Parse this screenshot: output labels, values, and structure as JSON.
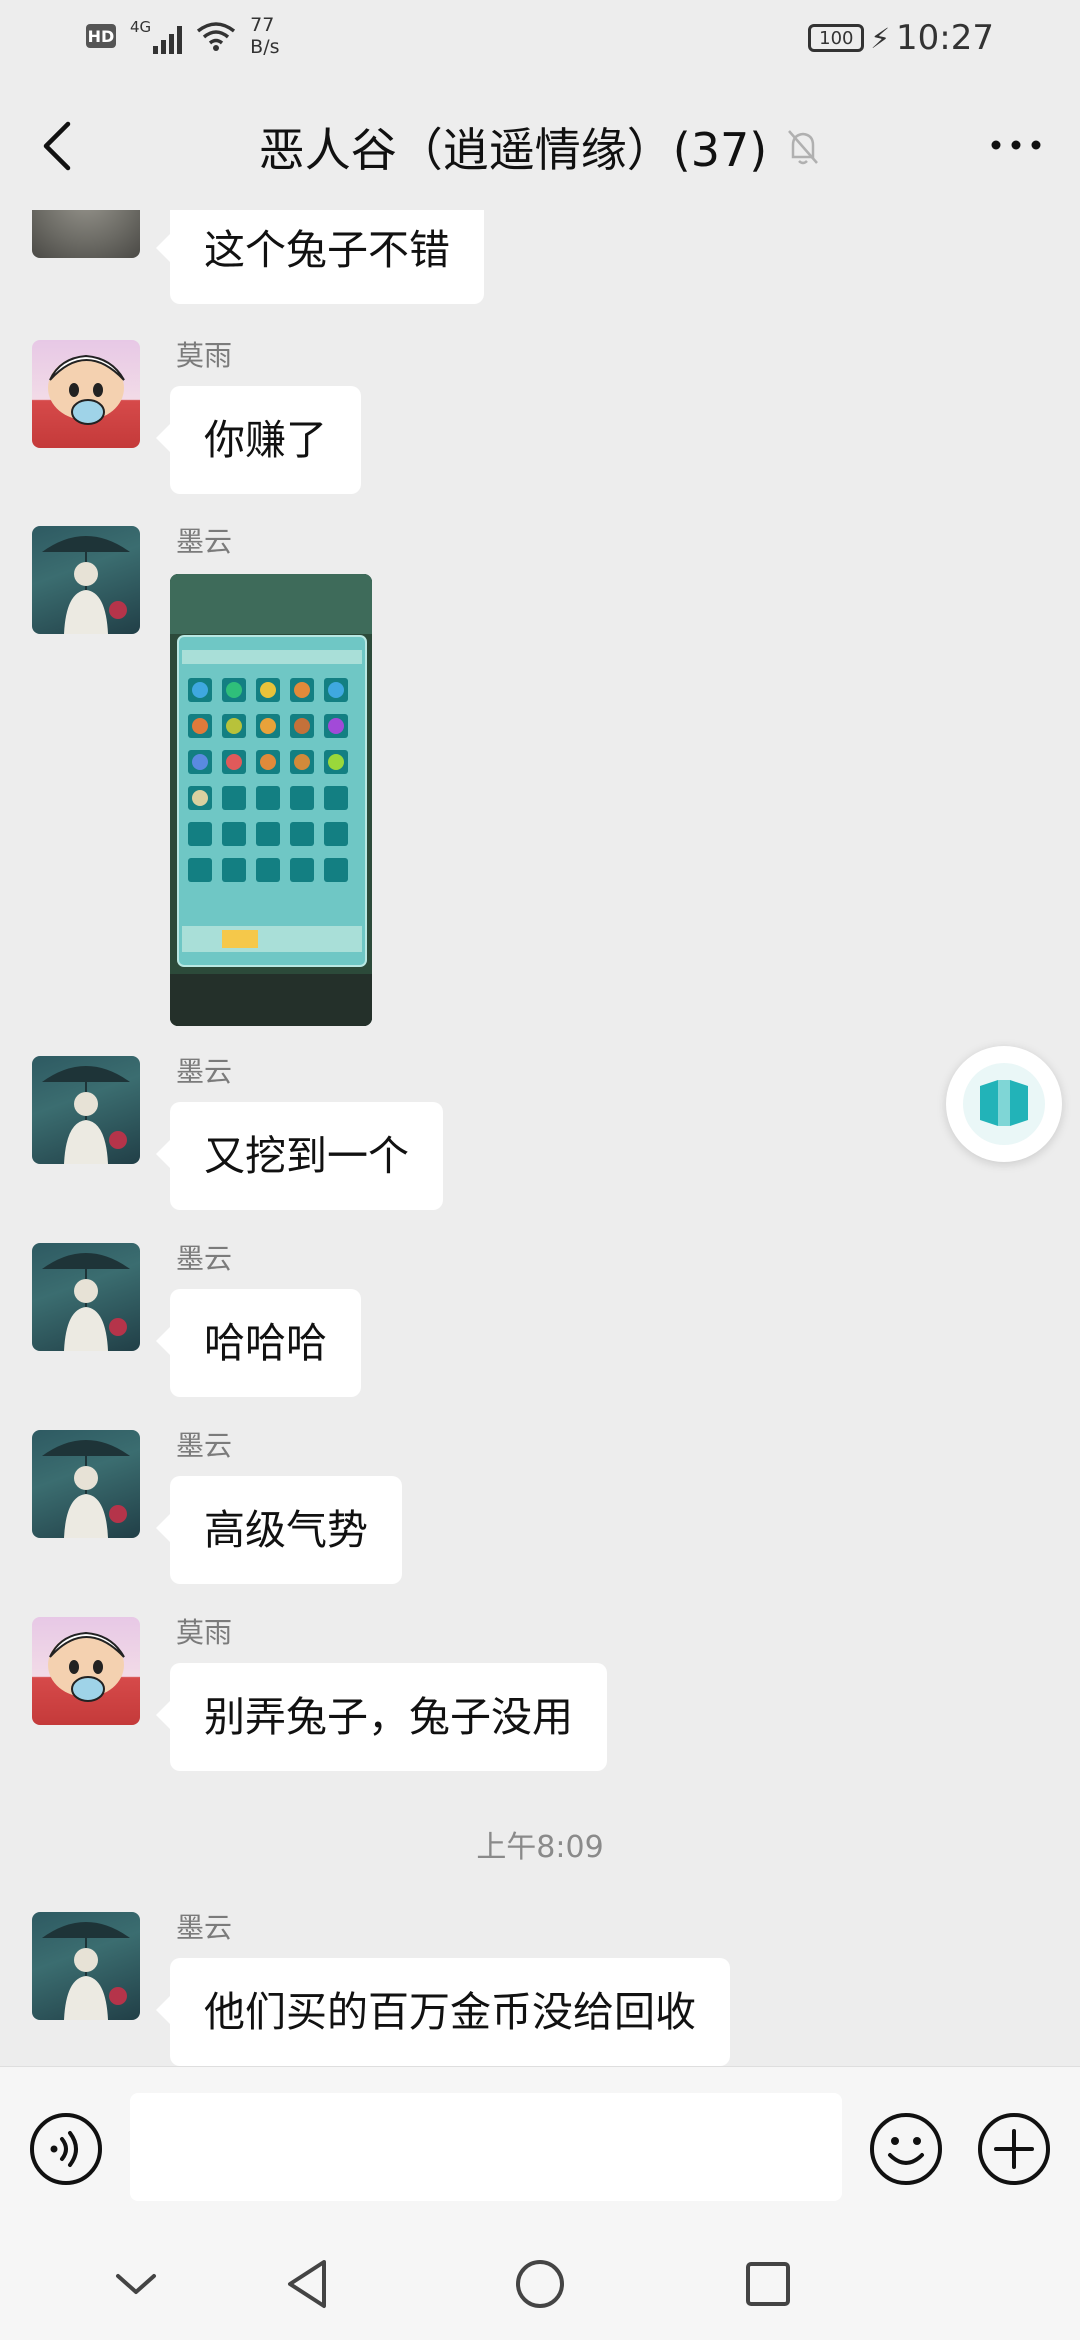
{
  "status_bar": {
    "hd": "HD",
    "network": "4G",
    "speed_value": "77",
    "speed_unit": "B/s",
    "battery": "100",
    "time": "10:27"
  },
  "header": {
    "title": "恶人谷（逍遥情缘）(37)",
    "back_icon": "chevron-left-icon",
    "mute_icon": "bell-off-icon",
    "more_icon": "more-horizontal-icon"
  },
  "messages": [
    {
      "type": "text",
      "sender": "",
      "text": "这个兔子不错",
      "avatar": "stone"
    },
    {
      "type": "text",
      "sender": "莫雨",
      "text": "你赚了",
      "avatar": "shinchan"
    },
    {
      "type": "image",
      "sender": "墨云",
      "avatar": "rain"
    },
    {
      "type": "text",
      "sender": "墨云",
      "text": "又挖到一个",
      "avatar": "rain"
    },
    {
      "type": "text",
      "sender": "墨云",
      "text": "哈哈哈",
      "avatar": "rain"
    },
    {
      "type": "text",
      "sender": "墨云",
      "text": "高级气势",
      "avatar": "rain"
    },
    {
      "type": "text",
      "sender": "莫雨",
      "text": "别弄兔子，兔子没用",
      "avatar": "shinchan"
    },
    {
      "type": "timestamp",
      "text": "上午8:09"
    },
    {
      "type": "text",
      "sender": "墨云",
      "text": "他们买的百万金币没给回收",
      "avatar": "rain"
    }
  ],
  "input_bar": {
    "voice_icon": "voice-icon",
    "input_value": "",
    "emoji_icon": "emoji-icon",
    "plus_icon": "plus-icon"
  },
  "nav_bar": {
    "icons": [
      "chevron-down-icon",
      "back-triangle-icon",
      "home-circle-icon",
      "recents-square-icon"
    ]
  },
  "colors": {
    "background": "#ededed",
    "bubble": "#ffffff",
    "sender": "#7b7b7b",
    "accent_float": "#22b3b8"
  }
}
